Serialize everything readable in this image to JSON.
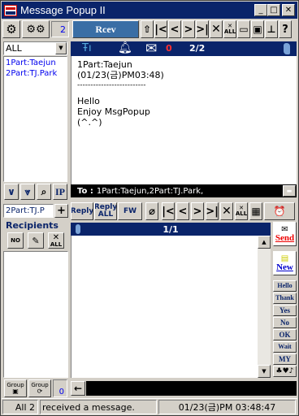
{
  "window": {
    "title": "Message Popup II"
  },
  "top_toolbar": {
    "counter": "2",
    "recv_label": "Rcev"
  },
  "filter": {
    "selected": "ALL",
    "arrow": "▼"
  },
  "users": [
    "1Part:Taejun",
    "2Part:TJ.Park"
  ],
  "message": {
    "count": "0",
    "page": "2/2",
    "lines": [
      "1Part:Taejun",
      "(01/23(금)PM03:48)",
      "--------------------------",
      "",
      "Hello",
      "Enjoy MsgPopup",
      "(^.^)"
    ],
    "to_label": "To :",
    "to_value": "1Part:Taejun,2Part:TJ.Park,"
  },
  "left_buttons": {
    "ip": "IP"
  },
  "recipient_input": {
    "value": "2Part:TJ.P",
    "add": "+"
  },
  "recipients": {
    "header": "Recipients",
    "no": "NO",
    "all": "ALL"
  },
  "compose_toolbar": {
    "reply": "Reply",
    "reply_all_1": "Reply",
    "reply_all_2": "ALL",
    "fw": "FW",
    "all_label": "ALL"
  },
  "compose": {
    "page": "1/1"
  },
  "right_panel": {
    "send": "Send",
    "new": "New",
    "quick": [
      "Hello",
      "Thank",
      "Yes",
      "No",
      "OK",
      "Wait",
      "MY"
    ],
    "extra": "♣♥♪"
  },
  "bottom": {
    "group1": "Group",
    "group2": "Group",
    "counter": "0",
    "back_arrow": "←"
  },
  "status": {
    "count": "All 2",
    "text": "received a message.",
    "time": "01/23(금)PM 03:48:47"
  }
}
